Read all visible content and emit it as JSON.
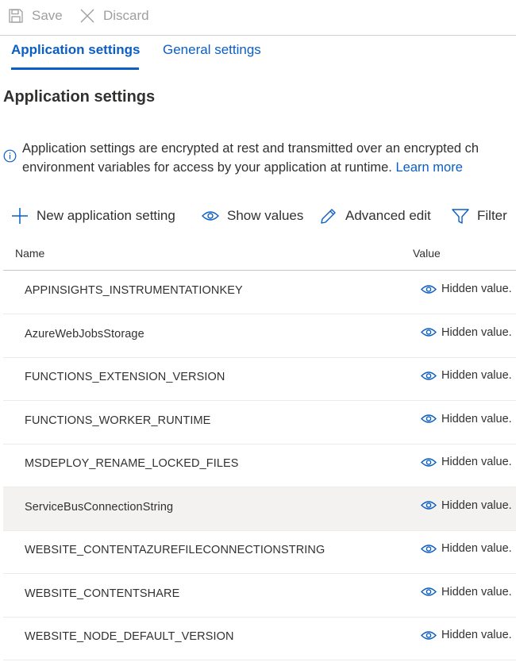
{
  "command_bar": {
    "save_label": "Save",
    "discard_label": "Discard"
  },
  "tabs": [
    {
      "label": "Application settings",
      "active": true
    },
    {
      "label": "General settings",
      "active": false
    }
  ],
  "section_title": "Application settings",
  "info": {
    "line1": "Application settings are encrypted at rest and transmitted over an encrypted ch",
    "line2": "environment variables for access by your application at runtime.",
    "learn_more": "Learn more"
  },
  "toolbar": {
    "new_setting": "New application setting",
    "show_values": "Show values",
    "advanced_edit": "Advanced edit",
    "filter": "Filter"
  },
  "table": {
    "columns": [
      "Name",
      "Value"
    ],
    "rows": [
      {
        "name": "APPINSIGHTS_INSTRUMENTATIONKEY",
        "value": "Hidden value."
      },
      {
        "name": "AzureWebJobsStorage",
        "value": "Hidden value."
      },
      {
        "name": "FUNCTIONS_EXTENSION_VERSION",
        "value": "Hidden value."
      },
      {
        "name": "FUNCTIONS_WORKER_RUNTIME",
        "value": "Hidden value."
      },
      {
        "name": "MSDEPLOY_RENAME_LOCKED_FILES",
        "value": "Hidden value."
      },
      {
        "name": "ServiceBusConnectionString",
        "value": "Hidden value."
      },
      {
        "name": "WEBSITE_CONTENTAZUREFILECONNECTIONSTRING",
        "value": "Hidden value."
      },
      {
        "name": "WEBSITE_CONTENTSHARE",
        "value": "Hidden value."
      },
      {
        "name": "WEBSITE_NODE_DEFAULT_VERSION",
        "value": "Hidden value."
      }
    ]
  },
  "colors": {
    "accent": "#0a5ec4",
    "disabled": "#a19f9d",
    "row_highlight": "#f3f2f1"
  },
  "icons": {
    "save": "save-icon",
    "discard": "close-icon",
    "info": "info-icon",
    "add": "plus-icon",
    "show": "eye-icon",
    "edit": "pencil-icon",
    "filter": "filter-icon"
  }
}
